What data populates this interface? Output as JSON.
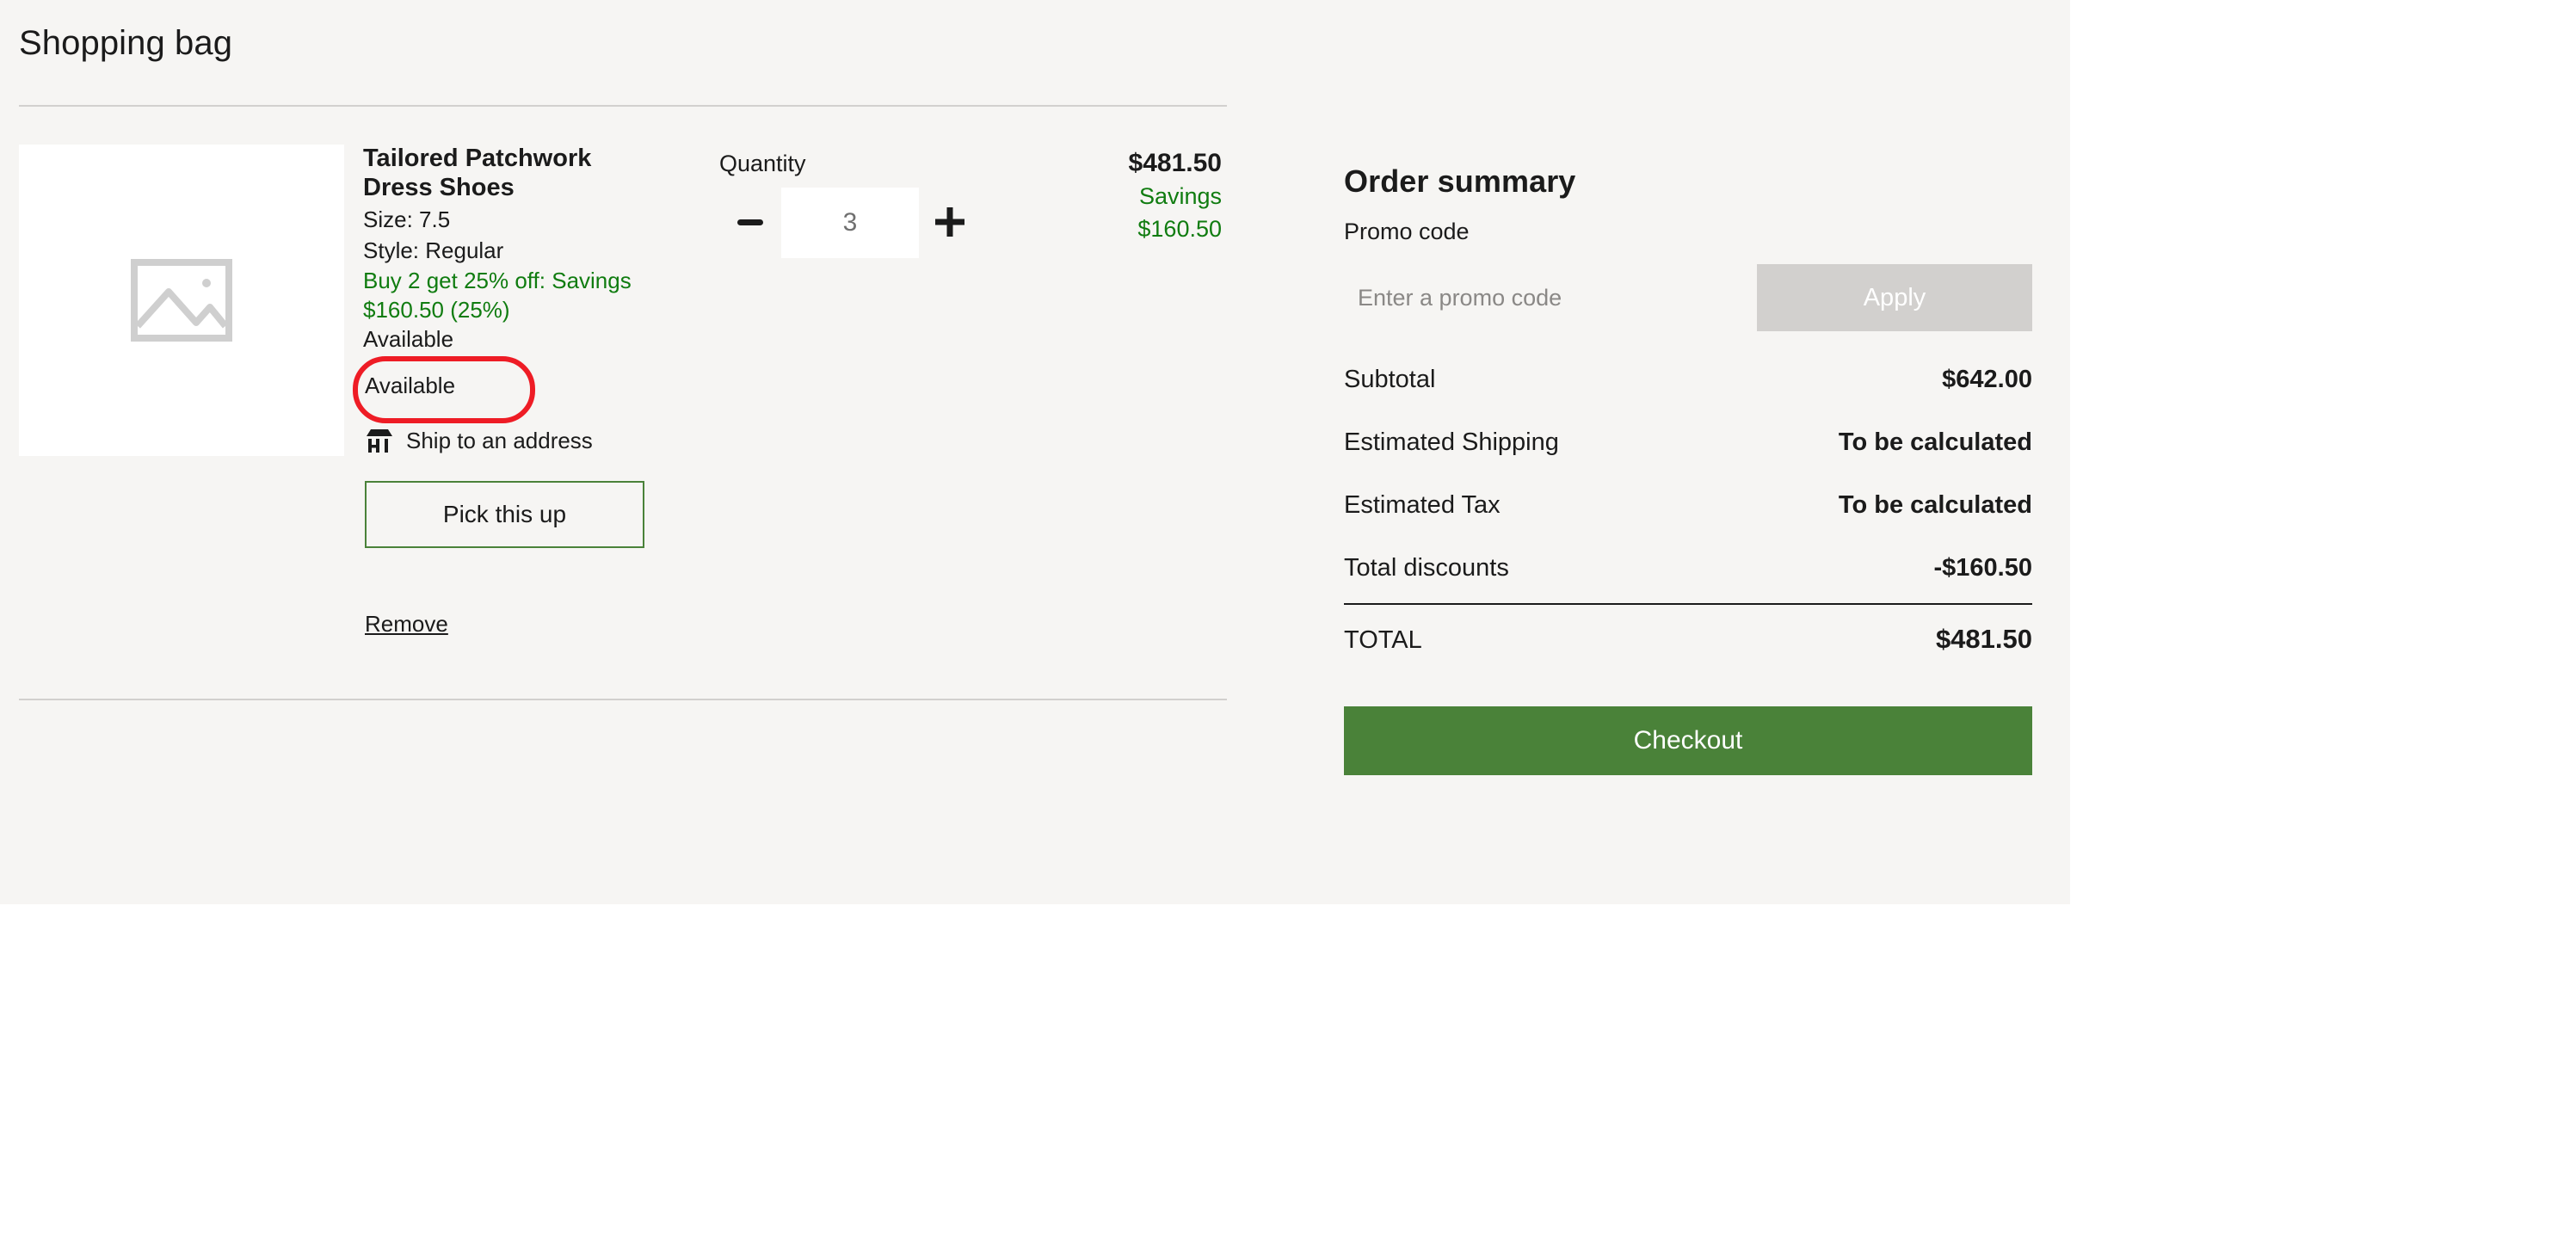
{
  "page": {
    "title": "Shopping bag",
    "background_color": "#f6f5f3"
  },
  "cart": {
    "items": [
      {
        "name": "Tailored Patchwork Dress Shoes",
        "image_placeholder_icon": "broken-image-icon",
        "size_label": "Size: 7.5",
        "style_label": "Style: Regular",
        "promo_text": "Buy 2 get 25% off: Savings $160.50 (25%)",
        "availability": "Available",
        "fulfillment_label": "Ship to an address",
        "fulfillment_icon": "store-icon",
        "pickup_button_label": "Pick this up",
        "remove_label": "Remove",
        "quantity_label": "Quantity",
        "quantity_value": "3",
        "decrease_icon": "minus-icon",
        "increase_icon": "plus-icon",
        "price": "$481.50",
        "savings_label": "Savings",
        "savings_amount": "$160.50"
      }
    ]
  },
  "summary": {
    "title": "Order summary",
    "promo_code_label": "Promo code",
    "promo_placeholder": "Enter a promo code",
    "promo_value": "",
    "apply_label": "Apply",
    "rows": [
      {
        "key": "Subtotal",
        "value": "$642.00"
      },
      {
        "key": "Estimated Shipping",
        "value": "To be calculated"
      },
      {
        "key": "Estimated Tax",
        "value": "To be calculated"
      },
      {
        "key": "Total discounts",
        "value": "-$160.50"
      }
    ],
    "total_label": "TOTAL",
    "total_value": "$481.50",
    "checkout_label": "Checkout"
  },
  "annotation": {
    "target_text": "Available",
    "color": "#ee1c25"
  },
  "colors": {
    "accent_green": "#4a8239",
    "promo_green": "#107c10",
    "text": "#1b1b1b",
    "muted": "#8a8886",
    "rule": "#d2d0ce",
    "disabled_button": "#d2d0ce"
  }
}
